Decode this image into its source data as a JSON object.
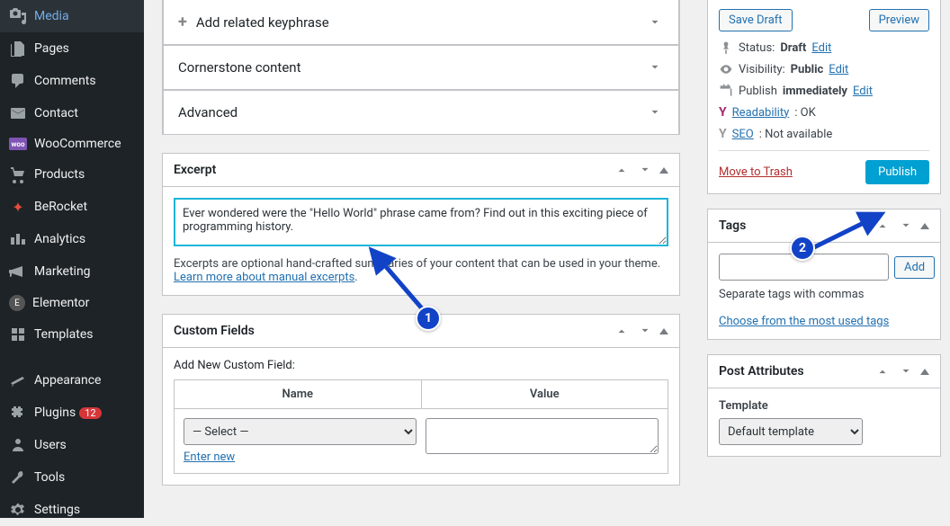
{
  "sidebar": {
    "items": [
      {
        "label": "Media",
        "icon": "media"
      },
      {
        "label": "Pages",
        "icon": "page"
      },
      {
        "label": "Comments",
        "icon": "comment"
      },
      {
        "label": "Contact",
        "icon": "mail"
      },
      {
        "label": "WooCommerce",
        "icon": "woo"
      },
      {
        "label": "Products",
        "icon": "product"
      },
      {
        "label": "BeRocket",
        "icon": "rocket"
      },
      {
        "label": "Analytics",
        "icon": "analytics"
      },
      {
        "label": "Marketing",
        "icon": "marketing"
      },
      {
        "label": "Elementor",
        "icon": "elementor"
      },
      {
        "label": "Templates",
        "icon": "templates"
      },
      {
        "label": "Appearance",
        "icon": "appearance"
      },
      {
        "label": "Plugins",
        "icon": "plugins",
        "badge": "12"
      },
      {
        "label": "Users",
        "icon": "users"
      },
      {
        "label": "Tools",
        "icon": "tools"
      },
      {
        "label": "Settings",
        "icon": "settings"
      }
    ]
  },
  "main": {
    "keyphrase_label": "Add related keyphrase",
    "cornerstone_label": "Cornerstone content",
    "advanced_label": "Advanced",
    "excerpt": {
      "title": "Excerpt",
      "value": "Ever wondered were the \"Hello World\" phrase came from? Find out in this exciting piece of programming history.",
      "help": "Excerpts are optional hand-crafted summaries of your content that can be used in your theme.",
      "link": "Learn more about manual excerpts"
    },
    "custom_fields": {
      "title": "Custom Fields",
      "add_label": "Add New Custom Field:",
      "name_col": "Name",
      "value_col": "Value",
      "select_placeholder": "— Select —",
      "enter_new": "Enter new"
    }
  },
  "publish": {
    "save_draft": "Save Draft",
    "preview": "Preview",
    "status_label": "Status:",
    "status_value": "Draft",
    "edit": "Edit",
    "visibility_label": "Visibility:",
    "visibility_value": "Public",
    "publish_label": "Publish",
    "immediately": "immediately",
    "readability_label": "Readability",
    "readability_status": ": OK",
    "seo_label": "SEO",
    "seo_status": ": Not available",
    "trash": "Move to Trash",
    "publish_btn": "Publish"
  },
  "tags": {
    "title": "Tags",
    "add": "Add",
    "help": "Separate tags with commas",
    "choose": "Choose from the most used tags"
  },
  "attributes": {
    "title": "Post Attributes",
    "template": "Template",
    "default_template": "Default template"
  },
  "annotations": {
    "step1": "1",
    "step2": "2"
  }
}
